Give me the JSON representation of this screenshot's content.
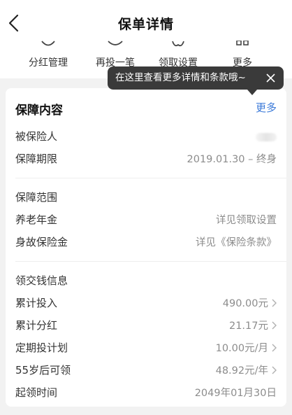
{
  "nav": {
    "title": "保单详情",
    "back_icon": "chevron-left-icon"
  },
  "quick_actions": [
    {
      "label": "分红管理",
      "icon": "dividend-icon"
    },
    {
      "label": "再投一笔",
      "icon": "reinvest-icon"
    },
    {
      "label": "领取设置",
      "icon": "claim-settings-icon"
    },
    {
      "label": "更多",
      "icon": "more-grid-icon"
    }
  ],
  "tooltip": {
    "text": "在这里查看更多详情和条款哦~",
    "close_icon": "close-icon"
  },
  "card": {
    "title": "保障内容",
    "more_label": "更多",
    "insured_label": "被保险人",
    "period_label": "保障期限",
    "period_value": "2019.01.30 – 终身",
    "scope_title": "保障范围",
    "scope_rows": [
      {
        "label": "养老年金",
        "value": "详见领取设置"
      },
      {
        "label": "身故保险金",
        "value": "详见《保险条款》"
      }
    ],
    "money_title": "领交钱信息",
    "money_rows": [
      {
        "label": "累计投入",
        "value": "490.00元",
        "chevron": true
      },
      {
        "label": "累计分红",
        "value": "21.17元",
        "chevron": true
      },
      {
        "label": "定期投计划",
        "value": "10.00元/月",
        "chevron": true
      },
      {
        "label": "55岁后可领",
        "value": "48.92元/年",
        "chevron": true
      },
      {
        "label": "起领时间",
        "value": "2049年01月30日",
        "chevron": false
      }
    ]
  },
  "colors": {
    "link": "#3d7bd9",
    "tooltip_bg": "#3a3a3a",
    "page_bg": "#f2f2f2",
    "value_gray": "#8c8c8c"
  }
}
